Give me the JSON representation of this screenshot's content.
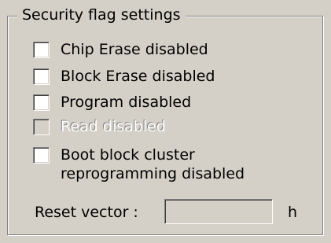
{
  "group": {
    "title": "Security flag settings"
  },
  "checkboxes": [
    {
      "label": "Chip Erase disabled",
      "checked": false,
      "enabled": true
    },
    {
      "label": "Block Erase disabled",
      "checked": false,
      "enabled": true
    },
    {
      "label": "Program disabled",
      "checked": false,
      "enabled": true
    },
    {
      "label": "Read disabled",
      "checked": false,
      "enabled": false
    },
    {
      "label": "Boot block cluster\nreprogramming disabled",
      "checked": false,
      "enabled": true
    }
  ],
  "reset_vector": {
    "label": "Reset vector :",
    "value": "",
    "unit": "h",
    "enabled": false
  }
}
